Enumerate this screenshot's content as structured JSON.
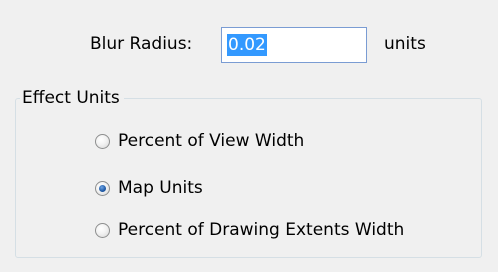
{
  "blur": {
    "label": "Blur Radius:",
    "value": "0.02",
    "units": "units"
  },
  "effect_units": {
    "title": "Effect Units",
    "options": [
      {
        "label": "Percent of View Width",
        "checked": false
      },
      {
        "label": "Map Units",
        "checked": true
      },
      {
        "label": "Percent of Drawing Extents Width",
        "checked": false
      }
    ]
  },
  "colors": {
    "background": "#f0f0f0",
    "selection": "#3399ff",
    "input_border": "#7a9cd3"
  }
}
